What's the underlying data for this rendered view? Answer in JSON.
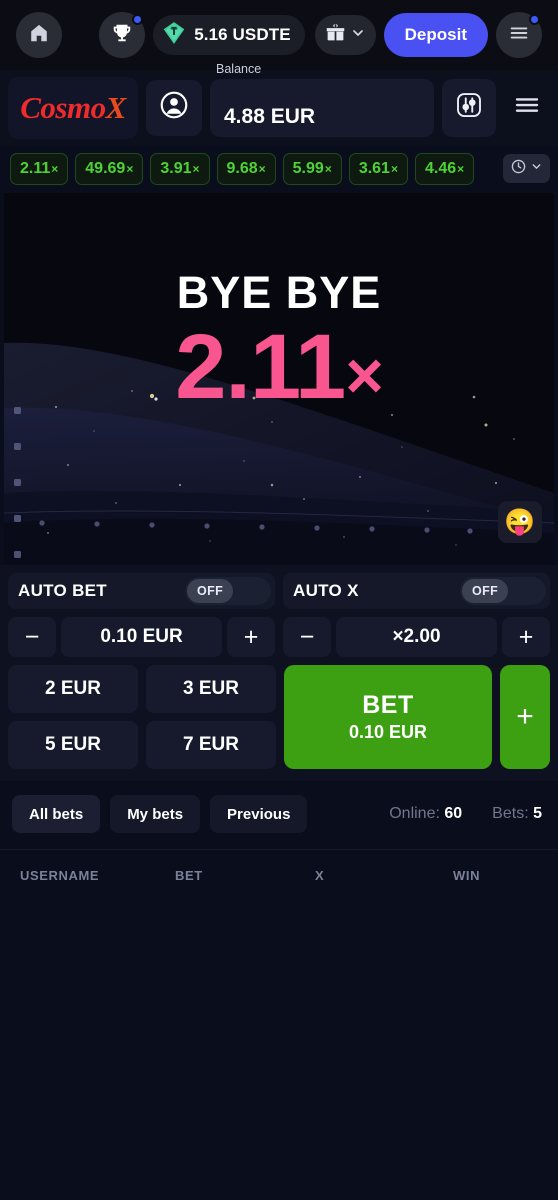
{
  "topbar": {
    "home_icon": "home-icon",
    "trophy_icon": "trophy-icon",
    "currency_icon": "tether-icon",
    "wallet_amount": "5.16 USDTE",
    "gift_icon": "gift-icon",
    "chevron_icon": "chevron-down-icon",
    "deposit_label": "Deposit",
    "menu_icon": "hamburger-icon"
  },
  "subbar": {
    "logo_main": "Cosmo",
    "logo_accent": "X",
    "avatar_icon": "user-avatar-icon",
    "balance_label": "Balance",
    "balance_value": "4.88 EUR",
    "settings_icon": "sliders-icon",
    "menu_icon": "hamburger-icon"
  },
  "history": {
    "multipliers": [
      "2.11",
      "49.69",
      "3.91",
      "9.68",
      "5.99",
      "3.61",
      "4.46"
    ],
    "suffix": "×",
    "clock_icon": "clock-icon",
    "chevron_icon": "chevron-down-icon"
  },
  "game": {
    "status_text": "BYE BYE",
    "crash_value": "2.11",
    "crash_suffix": "×",
    "emoji": "😜",
    "crash_color": "#f9568f"
  },
  "bet_panel": {
    "auto_bet_label": "AUTO BET",
    "auto_bet_state": "OFF",
    "auto_x_label": "AUTO X",
    "auto_x_state": "OFF",
    "minus_label": "−",
    "plus_label": "+",
    "bet_amount": "0.10 EUR",
    "auto_x_value": "×2.00",
    "quick_bets": [
      "2 EUR",
      "3 EUR",
      "5 EUR",
      "7 EUR"
    ],
    "bet_button_label": "BET",
    "bet_button_amount": "0.10 EUR",
    "bet_add_label": "+",
    "bet_color": "#3da012"
  },
  "bets": {
    "tabs": [
      {
        "label": "All bets",
        "active": true
      },
      {
        "label": "My bets",
        "active": false
      },
      {
        "label": "Previous",
        "active": false
      }
    ],
    "online_label": "Online:",
    "online_value": "60",
    "bets_label": "Bets:",
    "bets_value": "5",
    "columns": [
      "USERNAME",
      "BET",
      "X",
      "WIN"
    ],
    "rows": []
  }
}
